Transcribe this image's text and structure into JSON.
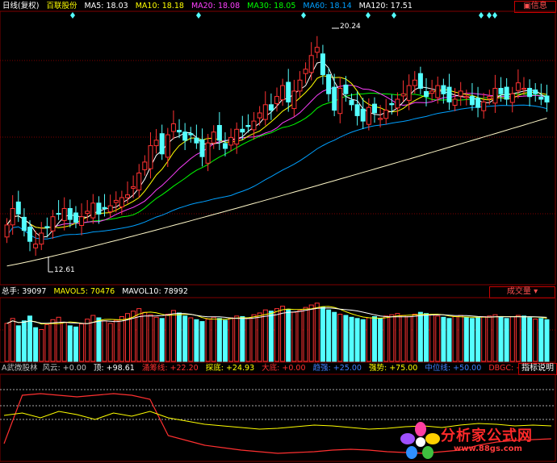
{
  "price_panel": {
    "period_label": "日线(复权)",
    "stock_name": "百联股份",
    "ma": [
      {
        "label": "MA5: 18.03",
        "color": "#ffffff"
      },
      {
        "label": "MA10: 18.18",
        "color": "#ffff00"
      },
      {
        "label": "MA20: 18.08",
        "color": "#ff40ff"
      },
      {
        "label": "MA30: 18.05",
        "color": "#00ff00"
      },
      {
        "label": "MA60: 18.14",
        "color": "#00a0ff"
      },
      {
        "label": "MA120: 17.51",
        "color": "#ffffff"
      }
    ],
    "high_label": "20.24",
    "low_label": "12.61",
    "button_text": "信息"
  },
  "volume_panel": {
    "total_label": "总手: 39097",
    "mavol5_label": "MAVOL5: 70476",
    "mavol10_label": "MAVOL10: 78992",
    "dropdown_label": "成交量"
  },
  "indicator_panel": {
    "name": "A武微股林",
    "items": [
      {
        "label": "风云: +0.00",
        "color": "#c0c0c0"
      },
      {
        "label": "顶: +98.61",
        "color": "#ffffff"
      },
      {
        "label": "涌筹线: +22.20",
        "color": "#ff3030"
      },
      {
        "label": "探底: +24.93",
        "color": "#ffff00"
      },
      {
        "label": "大底: +0.00",
        "color": "#ff3030"
      },
      {
        "label": "趋强: +25.00",
        "color": "#4080ff"
      },
      {
        "label": "强势: +75.00",
        "color": "#ffff00"
      },
      {
        "label": "中位线: +50.00",
        "color": "#4080ff"
      },
      {
        "label": "DBGC: +0.00",
        "color": "#ff3030"
      }
    ],
    "help_label": "指标说明"
  },
  "watermark": {
    "title": "分析家公式网",
    "url": "www.88gs.com"
  },
  "colors": {
    "up": "#ff3232",
    "down": "#54ffff",
    "grid": "#800000",
    "ma5": "#ffffff",
    "ma10": "#ffff00",
    "ma20": "#ff40ff",
    "ma30": "#00ff00",
    "ma60": "#00a0ff",
    "ma120": "#fff8c8"
  },
  "chart_data": {
    "type": "candlestick",
    "price_range": [
      11.5,
      21.3
    ],
    "closes": [
      13.6,
      14.2,
      14.0,
      13.4,
      13.0,
      12.9,
      13.3,
      13.5,
      13.9,
      14.0,
      14.2,
      13.8,
      13.7,
      13.9,
      14.1,
      14.4,
      14.0,
      14.2,
      14.3,
      14.5,
      14.6,
      14.7,
      15.0,
      15.5,
      15.9,
      16.5,
      16.7,
      16.2,
      16.9,
      17.3,
      17.0,
      16.7,
      16.9,
      16.6,
      16.1,
      16.6,
      17.0,
      16.7,
      16.4,
      16.8,
      17.1,
      17.0,
      17.2,
      17.4,
      17.7,
      18.0,
      17.8,
      18.3,
      18.7,
      18.1,
      18.5,
      18.9,
      19.3,
      19.8,
      20.1,
      19.1,
      18.4,
      17.8,
      18.6,
      18.4,
      18.0,
      17.6,
      17.4,
      17.9,
      17.7,
      17.5,
      17.8,
      18.0,
      18.2,
      18.4,
      18.7,
      18.9,
      18.6,
      18.3,
      18.5,
      18.7,
      18.4,
      18.1,
      18.2,
      18.5,
      18.3,
      18.0,
      17.9,
      18.1,
      18.3,
      18.6,
      18.4,
      18.2,
      18.4,
      18.8,
      18.6,
      18.3,
      18.4,
      18.2,
      18.1
    ],
    "ma120_start": 12.1,
    "ma120_end": 17.51,
    "high_point": 20.24,
    "low_point": 12.61,
    "volumes": [
      62,
      70,
      58,
      66,
      74,
      55,
      52,
      60,
      68,
      72,
      64,
      58,
      56,
      61,
      69,
      75,
      71,
      66,
      62,
      67,
      73,
      78,
      82,
      86,
      80,
      76,
      72,
      70,
      77,
      83,
      79,
      74,
      71,
      68,
      65,
      69,
      72,
      70,
      67,
      71,
      74,
      73,
      70,
      76,
      79,
      84,
      82,
      86,
      90,
      85,
      80,
      83,
      88,
      92,
      95,
      89,
      84,
      80,
      77,
      75,
      72,
      70,
      68,
      71,
      73,
      70,
      74,
      76,
      78,
      75,
      73,
      77,
      80,
      78,
      76,
      74,
      72,
      70,
      73,
      75,
      72,
      70,
      71,
      73,
      74,
      76,
      72,
      70,
      73,
      75,
      74,
      71,
      69,
      70,
      68
    ],
    "indicator_red": [
      20,
      80,
      82,
      80,
      78,
      80,
      82,
      80,
      75,
      30,
      24,
      18,
      15,
      12,
      10,
      8,
      9,
      10,
      12,
      13,
      12,
      10,
      9,
      8,
      10,
      12,
      18,
      22,
      24,
      25,
      26
    ],
    "indicator_yellow": [
      55,
      58,
      52,
      60,
      56,
      50,
      58,
      54,
      60,
      52,
      48,
      44,
      42,
      40,
      38,
      39,
      41,
      43,
      42,
      40,
      38,
      39,
      41,
      42,
      40,
      43,
      45,
      44,
      42,
      43,
      42
    ]
  }
}
